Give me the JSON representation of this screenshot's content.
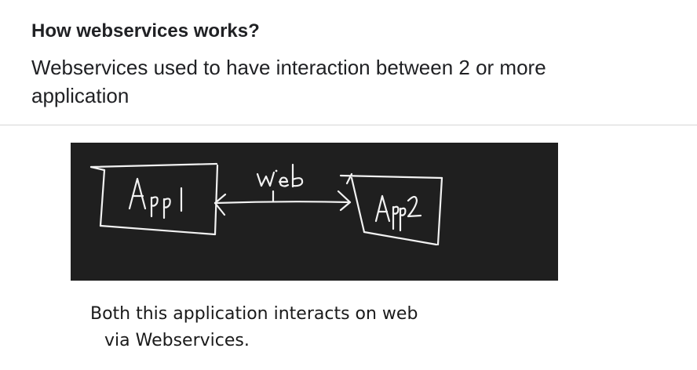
{
  "section": {
    "heading": "How webservices works?",
    "intro": "Webservices used to have interaction between 2 or more application"
  },
  "diagram": {
    "left_box_label": "App1",
    "right_box_label": "App2",
    "link_label": "Web",
    "style": "handwritten white chalk on dark board",
    "background_color": "#1f1f1f",
    "ink_color": "#f2f2f2"
  },
  "caption": {
    "line1": "Both this application interacts on web",
    "line2": "via Webservices."
  }
}
